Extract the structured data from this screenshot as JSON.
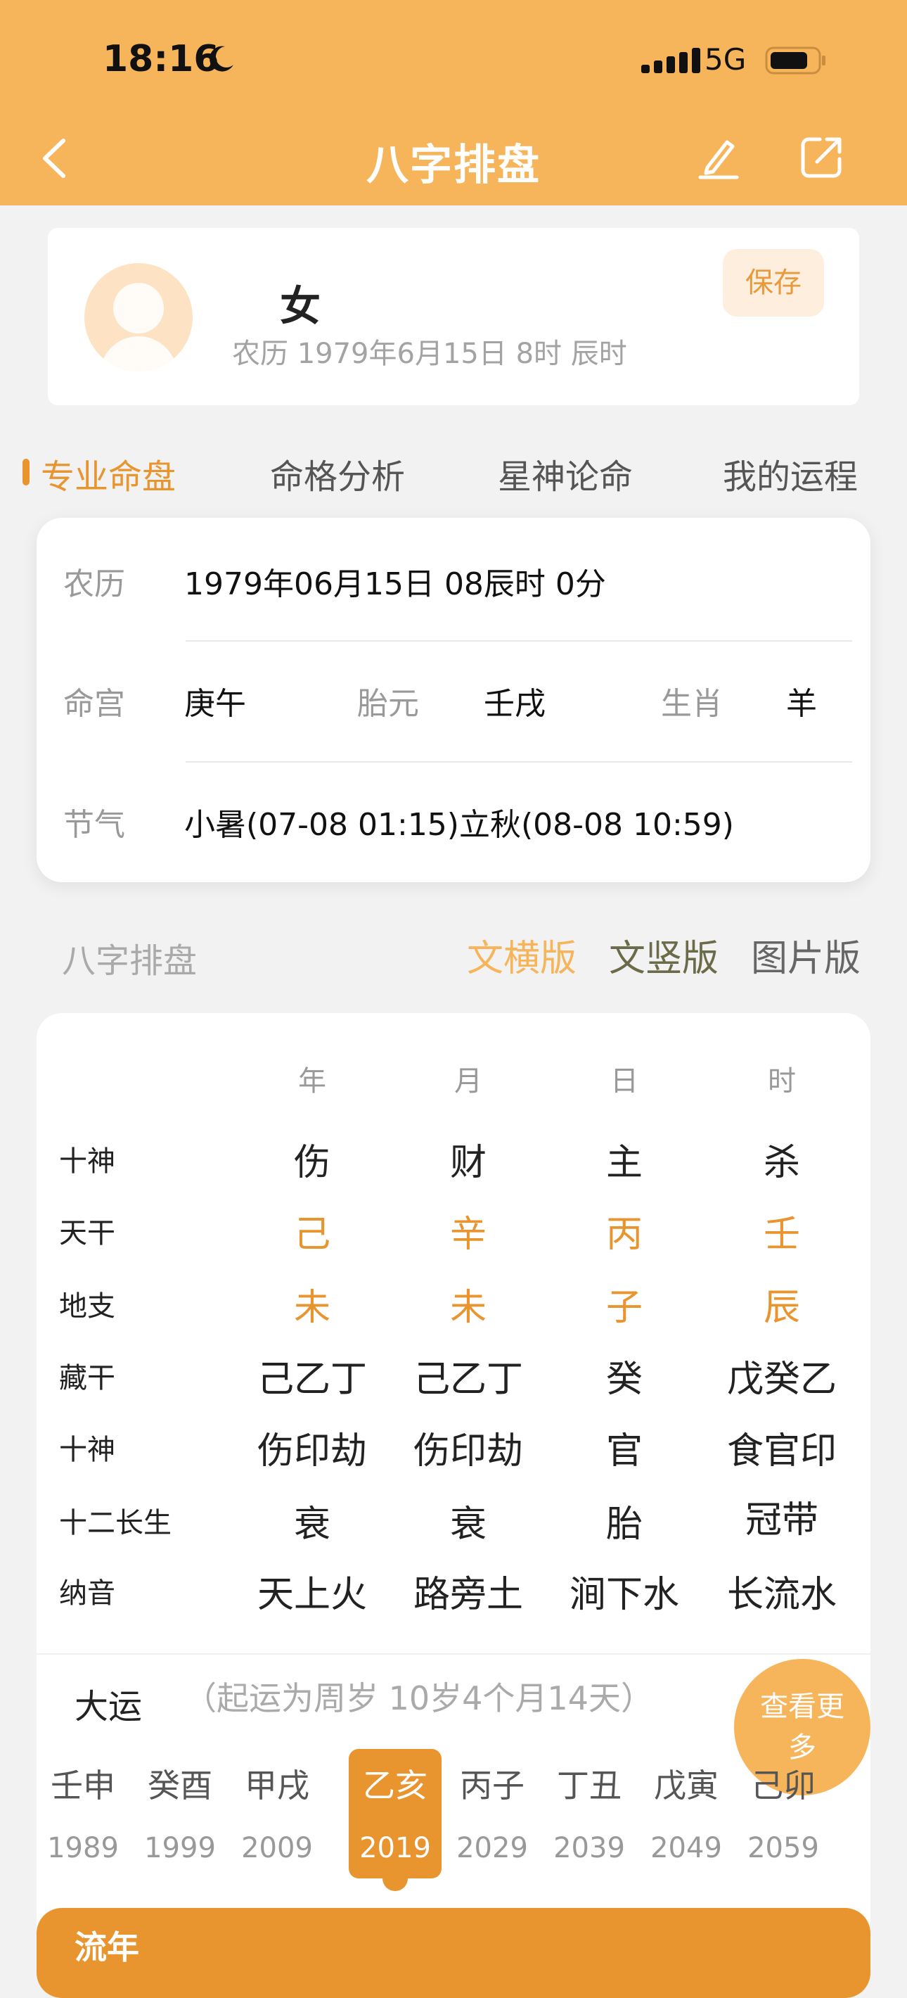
{
  "status": {
    "time": "18:16",
    "network": "5G"
  },
  "nav": {
    "title": "八字排盘"
  },
  "profile": {
    "gender": "女",
    "lunar_line": "农历 1979年6月15日 8时 辰时",
    "save_label": "保存"
  },
  "tabs": [
    {
      "label": "专业命盘",
      "active": true
    },
    {
      "label": "命格分析"
    },
    {
      "label": "星神论命"
    },
    {
      "label": "我的运程"
    }
  ],
  "info": {
    "lunar_label": "农历",
    "lunar_value": "1979年06月15日 08辰时 0分",
    "minggong_label": "命宫",
    "minggong_value": "庚午",
    "taiyuan_label": "胎元",
    "taiyuan_value": "壬戌",
    "shengxiao_label": "生肖",
    "shengxiao_value": "羊",
    "jieqi_label": "节气",
    "jieqi_value": "小暑(07-08 01:15)立秋(08-08 10:59)"
  },
  "bazi": {
    "section_title": "八字排盘",
    "versions": [
      "文横版",
      "文竖版",
      "图片版"
    ],
    "columns": [
      "年",
      "月",
      "日",
      "时"
    ],
    "rows": [
      {
        "label": "十神",
        "values": [
          "伤",
          "财",
          "主",
          "杀"
        ]
      },
      {
        "label": "天干",
        "values": [
          "己",
          "辛",
          "丙",
          "壬"
        ]
      },
      {
        "label": "地支",
        "values": [
          "未",
          "未",
          "子",
          "辰"
        ]
      },
      {
        "label": "藏干",
        "values": [
          "己乙丁",
          "己乙丁",
          "癸",
          "戊癸乙"
        ]
      },
      {
        "label": "十神",
        "values": [
          "伤印劫",
          "伤印劫",
          "官",
          "食官印"
        ]
      },
      {
        "label": "十二长生",
        "values": [
          "衰",
          "衰",
          "胎",
          "冠带"
        ]
      },
      {
        "label": "纳音",
        "values": [
          "天上火",
          "路旁土",
          "涧下水",
          "长流水"
        ]
      }
    ]
  },
  "dayun": {
    "title": "大运",
    "note": "（起运为周岁 10岁4个月14天）",
    "more_label": "查看更多",
    "items": [
      {
        "gz": "壬申",
        "year": "1989"
      },
      {
        "gz": "癸酉",
        "year": "1999"
      },
      {
        "gz": "甲戌",
        "year": "2009"
      },
      {
        "gz": "乙亥",
        "year": "2019",
        "selected": true
      },
      {
        "gz": "丙子",
        "year": "2029"
      },
      {
        "gz": "丁丑",
        "year": "2039"
      },
      {
        "gz": "戊寅",
        "year": "2049"
      },
      {
        "gz": "己卯",
        "year": "2059"
      }
    ]
  },
  "liunian": {
    "label": "流年"
  },
  "colors": {
    "header": "#f7b55b",
    "accent": "#e8952f",
    "ver_mid": "#6b6b4a"
  }
}
